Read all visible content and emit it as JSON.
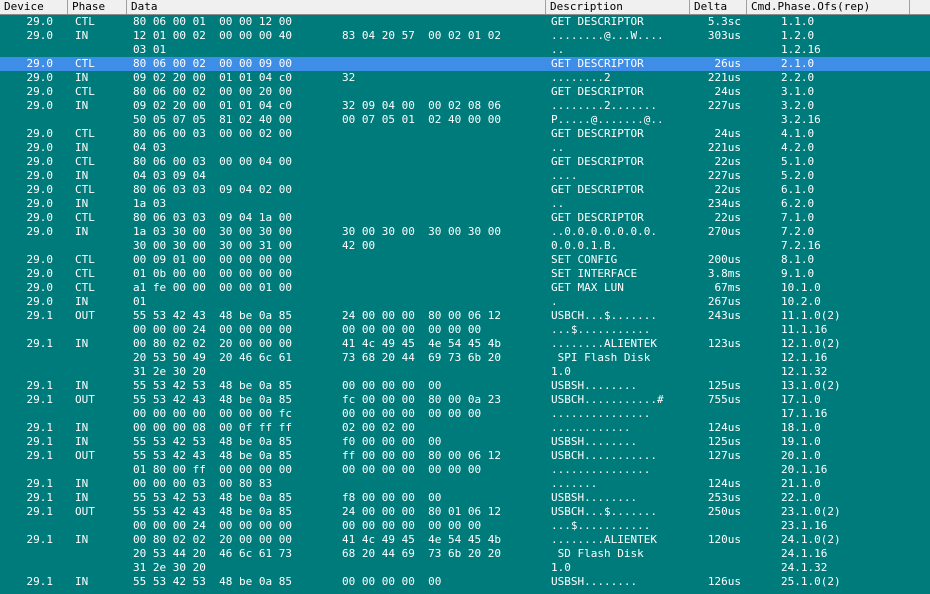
{
  "columns": {
    "device": "Device",
    "phase": "Phase",
    "data": "Data",
    "description": "Description",
    "delta": "Delta",
    "cmd": "Cmd.Phase.Ofs(rep)"
  },
  "colors": {
    "background": "#007b7b",
    "selected_row": "#3e8de6",
    "header_bg": "#f0f0f0",
    "text": "#ffffff"
  },
  "selected_index": 3,
  "rows": [
    {
      "device": "29.0",
      "phase": "CTL",
      "d1": "80 06 00 01  00 00 12 00",
      "d2": "",
      "desc": "GET DESCRIPTOR",
      "delta": "5.3sc",
      "cmd": "1.1.0"
    },
    {
      "device": "29.0",
      "phase": "IN",
      "d1": "12 01 00 02  00 00 00 40",
      "d2": "83 04 20 57  00 02 01 02",
      "desc": "........@...W....",
      "delta": "303us",
      "cmd": "1.2.0"
    },
    {
      "device": "",
      "phase": "",
      "d1": "03 01",
      "d2": "",
      "desc": "..",
      "delta": "",
      "cmd": "1.2.16"
    },
    {
      "device": "29.0",
      "phase": "CTL",
      "d1": "80 06 00 02  00 00 09 00",
      "d2": "",
      "desc": "GET DESCRIPTOR",
      "delta": "26us",
      "cmd": "2.1.0"
    },
    {
      "device": "29.0",
      "phase": "IN",
      "d1": "09 02 20 00  01 01 04 c0",
      "d2": "32",
      "desc": "........2",
      "delta": "221us",
      "cmd": "2.2.0"
    },
    {
      "device": "29.0",
      "phase": "CTL",
      "d1": "80 06 00 02  00 00 20 00",
      "d2": "",
      "desc": "GET DESCRIPTOR",
      "delta": "24us",
      "cmd": "3.1.0"
    },
    {
      "device": "29.0",
      "phase": "IN",
      "d1": "09 02 20 00  01 01 04 c0",
      "d2": "32 09 04 00  00 02 08 06",
      "desc": "........2.......",
      "delta": "227us",
      "cmd": "3.2.0"
    },
    {
      "device": "",
      "phase": "",
      "d1": "50 05 07 05  81 02 40 00",
      "d2": "00 07 05 01  02 40 00 00",
      "desc": "P.....@.......@..",
      "delta": "",
      "cmd": "3.2.16"
    },
    {
      "device": "29.0",
      "phase": "CTL",
      "d1": "80 06 00 03  00 00 02 00",
      "d2": "",
      "desc": "GET DESCRIPTOR",
      "delta": "24us",
      "cmd": "4.1.0"
    },
    {
      "device": "29.0",
      "phase": "IN",
      "d1": "04 03",
      "d2": "",
      "desc": "..",
      "delta": "221us",
      "cmd": "4.2.0"
    },
    {
      "device": "29.0",
      "phase": "CTL",
      "d1": "80 06 00 03  00 00 04 00",
      "d2": "",
      "desc": "GET DESCRIPTOR",
      "delta": "22us",
      "cmd": "5.1.0"
    },
    {
      "device": "29.0",
      "phase": "IN",
      "d1": "04 03 09 04",
      "d2": "",
      "desc": "....",
      "delta": "227us",
      "cmd": "5.2.0"
    },
    {
      "device": "29.0",
      "phase": "CTL",
      "d1": "80 06 03 03  09 04 02 00",
      "d2": "",
      "desc": "GET DESCRIPTOR",
      "delta": "22us",
      "cmd": "6.1.0"
    },
    {
      "device": "29.0",
      "phase": "IN",
      "d1": "1a 03",
      "d2": "",
      "desc": "..",
      "delta": "234us",
      "cmd": "6.2.0"
    },
    {
      "device": "29.0",
      "phase": "CTL",
      "d1": "80 06 03 03  09 04 1a 00",
      "d2": "",
      "desc": "GET DESCRIPTOR",
      "delta": "22us",
      "cmd": "7.1.0"
    },
    {
      "device": "29.0",
      "phase": "IN",
      "d1": "1a 03 30 00  30 00 30 00",
      "d2": "30 00 30 00  30 00 30 00",
      "desc": "..0.0.0.0.0.0.0.",
      "delta": "270us",
      "cmd": "7.2.0"
    },
    {
      "device": "",
      "phase": "",
      "d1": "30 00 30 00  30 00 31 00",
      "d2": "42 00",
      "desc": "0.0.0.1.B.",
      "delta": "",
      "cmd": "7.2.16"
    },
    {
      "device": "29.0",
      "phase": "CTL",
      "d1": "00 09 01 00  00 00 00 00",
      "d2": "",
      "desc": "SET CONFIG",
      "delta": "200us",
      "cmd": "8.1.0"
    },
    {
      "device": "29.0",
      "phase": "CTL",
      "d1": "01 0b 00 00  00 00 00 00",
      "d2": "",
      "desc": "SET INTERFACE",
      "delta": "3.8ms",
      "cmd": "9.1.0"
    },
    {
      "device": "29.0",
      "phase": "CTL",
      "d1": "a1 fe 00 00  00 00 01 00",
      "d2": "",
      "desc": "GET MAX LUN",
      "delta": "67ms",
      "cmd": "10.1.0"
    },
    {
      "device": "29.0",
      "phase": "IN",
      "d1": "01",
      "d2": "",
      "desc": ".",
      "delta": "267us",
      "cmd": "10.2.0"
    },
    {
      "device": "29.1",
      "phase": "OUT",
      "d1": "55 53 42 43  48 be 0a 85",
      "d2": "24 00 00 00  80 00 06 12",
      "desc": "USBCH...$.......",
      "delta": "243us",
      "cmd": "11.1.0(2)"
    },
    {
      "device": "",
      "phase": "",
      "d1": "00 00 00 24  00 00 00 00",
      "d2": "00 00 00 00  00 00 00",
      "desc": "...$...........",
      "delta": "",
      "cmd": "11.1.16"
    },
    {
      "device": "29.1",
      "phase": "IN",
      "d1": "00 80 02 02  20 00 00 00",
      "d2": "41 4c 49 45  4e 54 45 4b",
      "desc": "........ALIENTEK",
      "delta": "123us",
      "cmd": "12.1.0(2)"
    },
    {
      "device": "",
      "phase": "",
      "d1": "20 53 50 49  20 46 6c 61",
      "d2": "73 68 20 44  69 73 6b 20",
      "desc": " SPI Flash Disk",
      "delta": "",
      "cmd": "12.1.16"
    },
    {
      "device": "",
      "phase": "",
      "d1": "31 2e 30 20",
      "d2": "",
      "desc": "1.0",
      "delta": "",
      "cmd": "12.1.32"
    },
    {
      "device": "29.1",
      "phase": "IN",
      "d1": "55 53 42 53  48 be 0a 85",
      "d2": "00 00 00 00  00",
      "desc": "USBSH........",
      "delta": "125us",
      "cmd": "13.1.0(2)"
    },
    {
      "device": "29.1",
      "phase": "OUT",
      "d1": "55 53 42 43  48 be 0a 85",
      "d2": "fc 00 00 00  80 00 0a 23",
      "desc": "USBCH...........#",
      "delta": "755us",
      "cmd": "17.1.0"
    },
    {
      "device": "",
      "phase": "",
      "d1": "00 00 00 00  00 00 00 fc",
      "d2": "00 00 00 00  00 00 00",
      "desc": "...............",
      "delta": "",
      "cmd": "17.1.16"
    },
    {
      "device": "29.1",
      "phase": "IN",
      "d1": "00 00 00 08  00 0f ff ff",
      "d2": "02 00 02 00",
      "desc": "............",
      "delta": "124us",
      "cmd": "18.1.0"
    },
    {
      "device": "29.1",
      "phase": "IN",
      "d1": "55 53 42 53  48 be 0a 85",
      "d2": "f0 00 00 00  00",
      "desc": "USBSH........",
      "delta": "125us",
      "cmd": "19.1.0"
    },
    {
      "device": "29.1",
      "phase": "OUT",
      "d1": "55 53 42 43  48 be 0a 85",
      "d2": "ff 00 00 00  80 00 06 12",
      "desc": "USBCH...........",
      "delta": "127us",
      "cmd": "20.1.0"
    },
    {
      "device": "",
      "phase": "",
      "d1": "01 80 00 ff  00 00 00 00",
      "d2": "00 00 00 00  00 00 00",
      "desc": "...............",
      "delta": "",
      "cmd": "20.1.16"
    },
    {
      "device": "29.1",
      "phase": "IN",
      "d1": "00 00 00 03  00 80 83",
      "d2": "",
      "desc": ".......",
      "delta": "124us",
      "cmd": "21.1.0"
    },
    {
      "device": "29.1",
      "phase": "IN",
      "d1": "55 53 42 53  48 be 0a 85",
      "d2": "f8 00 00 00  00",
      "desc": "USBSH........",
      "delta": "253us",
      "cmd": "22.1.0"
    },
    {
      "device": "29.1",
      "phase": "OUT",
      "d1": "55 53 42 43  48 be 0a 85",
      "d2": "24 00 00 00  80 01 06 12",
      "desc": "USBCH...$.......",
      "delta": "250us",
      "cmd": "23.1.0(2)"
    },
    {
      "device": "",
      "phase": "",
      "d1": "00 00 00 24  00 00 00 00",
      "d2": "00 00 00 00  00 00 00",
      "desc": "...$...........",
      "delta": "",
      "cmd": "23.1.16"
    },
    {
      "device": "29.1",
      "phase": "IN",
      "d1": "00 80 02 02  20 00 00 00",
      "d2": "41 4c 49 45  4e 54 45 4b",
      "desc": "........ALIENTEK",
      "delta": "120us",
      "cmd": "24.1.0(2)"
    },
    {
      "device": "",
      "phase": "",
      "d1": "20 53 44 20  46 6c 61 73",
      "d2": "68 20 44 69  73 6b 20 20",
      "desc": " SD Flash Disk",
      "delta": "",
      "cmd": "24.1.16"
    },
    {
      "device": "",
      "phase": "",
      "d1": "31 2e 30 20",
      "d2": "",
      "desc": "1.0",
      "delta": "",
      "cmd": "24.1.32"
    },
    {
      "device": "29.1",
      "phase": "IN",
      "d1": "55 53 42 53  48 be 0a 85",
      "d2": "00 00 00 00  00",
      "desc": "USBSH........",
      "delta": "126us",
      "cmd": "25.1.0(2)"
    }
  ]
}
